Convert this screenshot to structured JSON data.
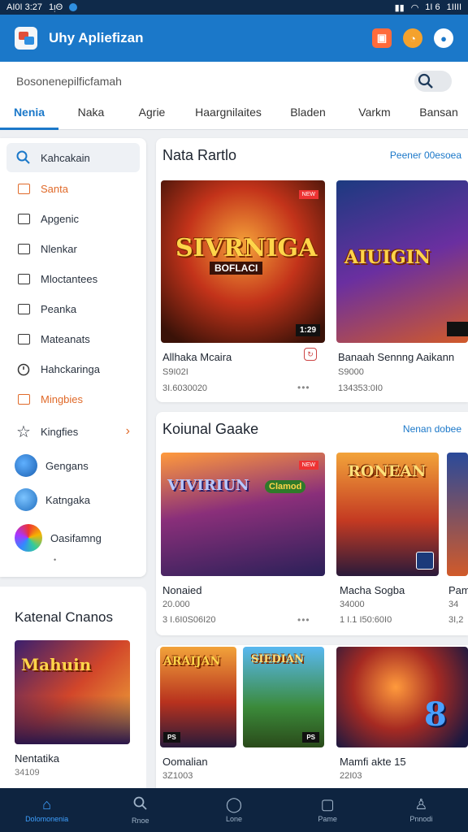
{
  "status": {
    "time": "AI0I 3:27",
    "left_extra": "1ᴉΘ",
    "right": "1I 6",
    "battery": "1IIII"
  },
  "app": {
    "title": "Uhy Apliefizan"
  },
  "search": {
    "placeholder": "Bosonenepilficfamah"
  },
  "tabs": [
    {
      "label": "Nenia",
      "active": true
    },
    {
      "label": "Naka"
    },
    {
      "label": "Agrie"
    },
    {
      "label": "Haargnilaites"
    },
    {
      "label": "Bladen"
    },
    {
      "label": "Varkm"
    },
    {
      "label": "Bansan"
    }
  ],
  "sidebar": {
    "items": [
      {
        "label": "Kahcakain",
        "icon": "search-icon"
      },
      {
        "label": "Santa",
        "icon": "checkbox-icon",
        "accent": true
      },
      {
        "label": "Apgenic",
        "icon": "checkbox-icon"
      },
      {
        "label": "Nlenkar",
        "icon": "checkbox-icon"
      },
      {
        "label": "Mloctantees",
        "icon": "checkbox-icon"
      },
      {
        "label": "Peanka",
        "icon": "checkbox-icon"
      },
      {
        "label": "Mateanats",
        "icon": "checkbox-icon"
      },
      {
        "label": "Hahckaringa",
        "icon": "clock-icon"
      },
      {
        "label": "Mingbies",
        "icon": "checkbox-icon",
        "accent": true
      },
      {
        "label": "Kingfies",
        "icon": "star-icon"
      },
      {
        "label": "Gengans",
        "icon": "avatar"
      },
      {
        "label": "Katngaka",
        "icon": "avatar"
      },
      {
        "label": "Oasifamng",
        "icon": "avatar"
      }
    ],
    "small_text": "•"
  },
  "promo": {
    "title": "Katenal Cnanos",
    "game_name": "Nentatika",
    "game_value": "34109"
  },
  "section1": {
    "title": "Nata Rartlo",
    "link": "Peener 00esoea",
    "cards": [
      {
        "name": "Allhaka Mcaira",
        "val1": "S9I02I",
        "val2": "3I.6030020",
        "tag": "1:29",
        "game_title": "SIVRNIGA",
        "sub": "BOFLACI"
      },
      {
        "name": "Banaah Sennng Aaikann",
        "val1": "S9000",
        "val2": "134353:0I0",
        "tag": "",
        "game_title": "AIUIGIN",
        "sub": ""
      }
    ]
  },
  "section2": {
    "title": "Koiunal Gaake",
    "link": "Nenan dobee",
    "cards": [
      {
        "name": "Nonaied",
        "val1": "20.000",
        "val2": "3 I.6I0S06I20",
        "game_title": "VIVIRIUN",
        "sub": "Clamod"
      },
      {
        "name": "Macha Sogba",
        "val1": "34000",
        "val2": "1 I.1 I50:60I0",
        "game_title": "RONEAN",
        "sub": ""
      },
      {
        "name": "Pam",
        "val1": "34",
        "val2": "3I,2",
        "game_title": "",
        "sub": ""
      }
    ]
  },
  "section3": {
    "cards": [
      {
        "name": "Oomalian",
        "val1": "3Z1003",
        "game_title": "ARAIJAN",
        "game_title2": "SIEDIAN"
      },
      {
        "name": "Mamfi akte 15",
        "val1": "22I03",
        "game_title": "8"
      }
    ]
  },
  "bottomnav": [
    {
      "label": "Dolomonenia",
      "icon": "home-icon",
      "active": true
    },
    {
      "label": "Rnoe",
      "icon": "search-icon"
    },
    {
      "label": "Lone",
      "icon": "circle-icon"
    },
    {
      "label": "Pame",
      "icon": "gamepad-icon"
    },
    {
      "label": "Pnnodi",
      "icon": "profile-icon"
    }
  ]
}
